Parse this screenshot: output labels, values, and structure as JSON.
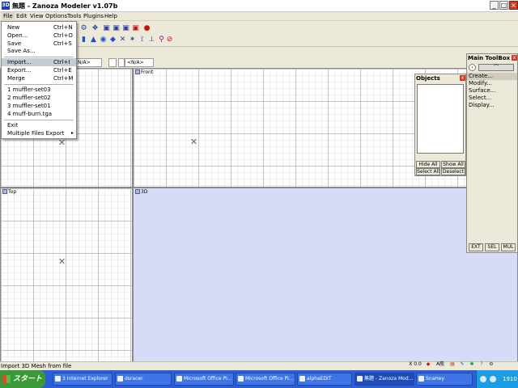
{
  "window": {
    "icon_text": "3D",
    "title": "無題 - Zanoza Modeler v1.07b"
  },
  "menubar": [
    "File",
    "Edit",
    "View",
    "Options",
    "Tools",
    "Plugins",
    "Help"
  ],
  "toolbar": {
    "icons": [
      "chain-icon",
      "palette-icon",
      "face-icon",
      "tag-icon",
      "cube-front-icon",
      "cube-side-icon",
      "cube-top-icon",
      "cube-red-icon",
      "sphere-icon",
      "blue-drop-icon",
      "blue-cone-icon",
      "pyramid-icon",
      "bulb-icon",
      "sphere-blue-icon",
      "axis-move-icon",
      "axis-rotate-icon",
      "axis-scale-icon",
      "axis-free-icon",
      "magnet-icon",
      "no-entry-icon"
    ]
  },
  "coords": {
    "field1": "<N/A>",
    "field2": "<N/A>"
  },
  "file_menu": {
    "items": [
      {
        "label": "New",
        "shortcut": "Ctrl+N"
      },
      {
        "label": "Open...",
        "shortcut": "Ctrl+O"
      },
      {
        "label": "Save",
        "shortcut": "Ctrl+S"
      },
      {
        "label": "Save As...",
        "shortcut": ""
      },
      {
        "label": "Import...",
        "shortcut": "Ctrl+I"
      },
      {
        "label": "Export...",
        "shortcut": "Ctrl+E"
      },
      {
        "label": "Merge",
        "shortcut": "Ctrl+M"
      },
      {
        "label": "1 muffler-set03",
        "shortcut": ""
      },
      {
        "label": "2 muffler-set02",
        "shortcut": ""
      },
      {
        "label": "3 muffler-set01",
        "shortcut": ""
      },
      {
        "label": "4 muff-burn.tga",
        "shortcut": ""
      },
      {
        "label": "Exit",
        "shortcut": ""
      },
      {
        "label": "Multiple Files Export",
        "shortcut": ""
      }
    ],
    "highlighted": "Import..."
  },
  "viewports": {
    "front": "Front",
    "top": "Top",
    "three_d": "3D"
  },
  "objects_panel": {
    "title": "Objects",
    "close": "x",
    "hide_all": "Hide All",
    "show_all": "Show All",
    "select_all": "Select All",
    "deselect": "Deselect"
  },
  "toolbox": {
    "title": "Main ToolBox",
    "close": "x",
    "items": [
      "Create...",
      "Modify...",
      "Surface...",
      "Select...",
      "Display..."
    ],
    "highlighted": "Create...",
    "modes": [
      "EXT",
      "SEL",
      "MUL"
    ]
  },
  "status": {
    "message": "Import 3D Mesh from file"
  },
  "ime": {
    "label": "X 0.0",
    "letters": "A般"
  },
  "taskbar": {
    "start_label": "スタート",
    "tasks": [
      "3 Internet Explorer",
      "dsracer",
      "Microsoft Office Pi...",
      "Microsoft Office Pi...",
      "alphaEDIT",
      "無題 - Zanoza Mod...",
      "SnaHey"
    ],
    "active_task": "無題 - Zanoza Mod...",
    "clock": "1910"
  },
  "colors": {
    "viewport_3d": "#d6dcf8",
    "taskbar": "#2c5fd6",
    "start_button": "#3a9a38"
  }
}
